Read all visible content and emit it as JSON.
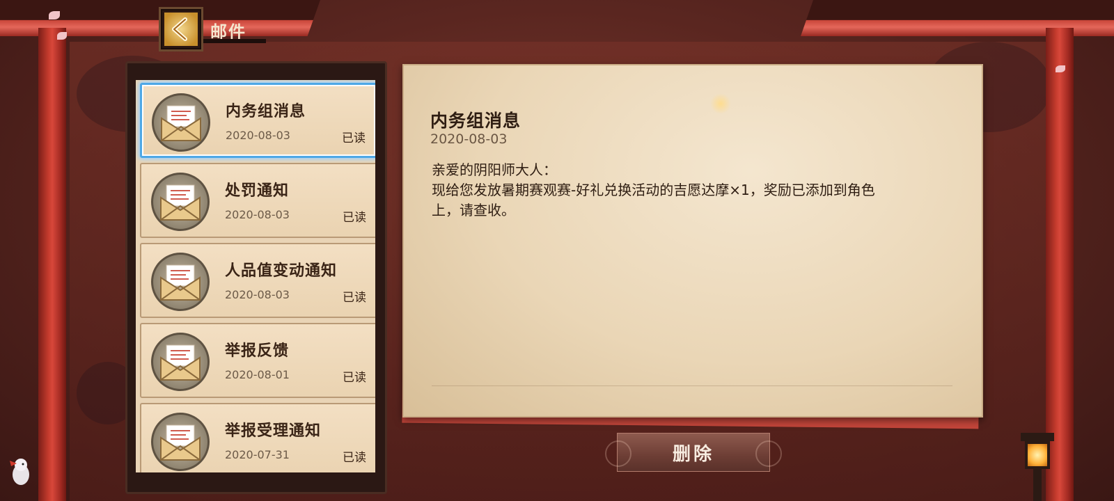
{
  "header": {
    "title": "邮件",
    "back_icon": "chevron-left-icon"
  },
  "mail_list": [
    {
      "title": "内务组消息",
      "date": "2020-08-03",
      "status": "已读",
      "icon": "envelope-icon",
      "selected": true
    },
    {
      "title": "处罚通知",
      "date": "2020-08-03",
      "status": "已读",
      "icon": "envelope-icon",
      "selected": false
    },
    {
      "title": "人品值变动通知",
      "date": "2020-08-03",
      "status": "已读",
      "icon": "envelope-icon",
      "selected": false
    },
    {
      "title": "举报反馈",
      "date": "2020-08-01",
      "status": "已读",
      "icon": "envelope-icon",
      "selected": false
    },
    {
      "title": "举报受理通知",
      "date": "2020-07-31",
      "status": "已读",
      "icon": "envelope-icon",
      "selected": false
    }
  ],
  "letter": {
    "title": "内务组消息",
    "date": "2020-08-03",
    "greeting": "亲爱的阴阳师大人：",
    "body_line1": "现给您发放暑期赛观赛-好礼兑换活动的吉愿达摩×1，奖励已添加到角色",
    "body_line2": "上，请查收。"
  },
  "actions": {
    "delete_label": "删除"
  },
  "colors": {
    "selected_border": "#4ea8e6",
    "pillar_red": "#c23a2c",
    "paper": "#f4e6cf"
  }
}
